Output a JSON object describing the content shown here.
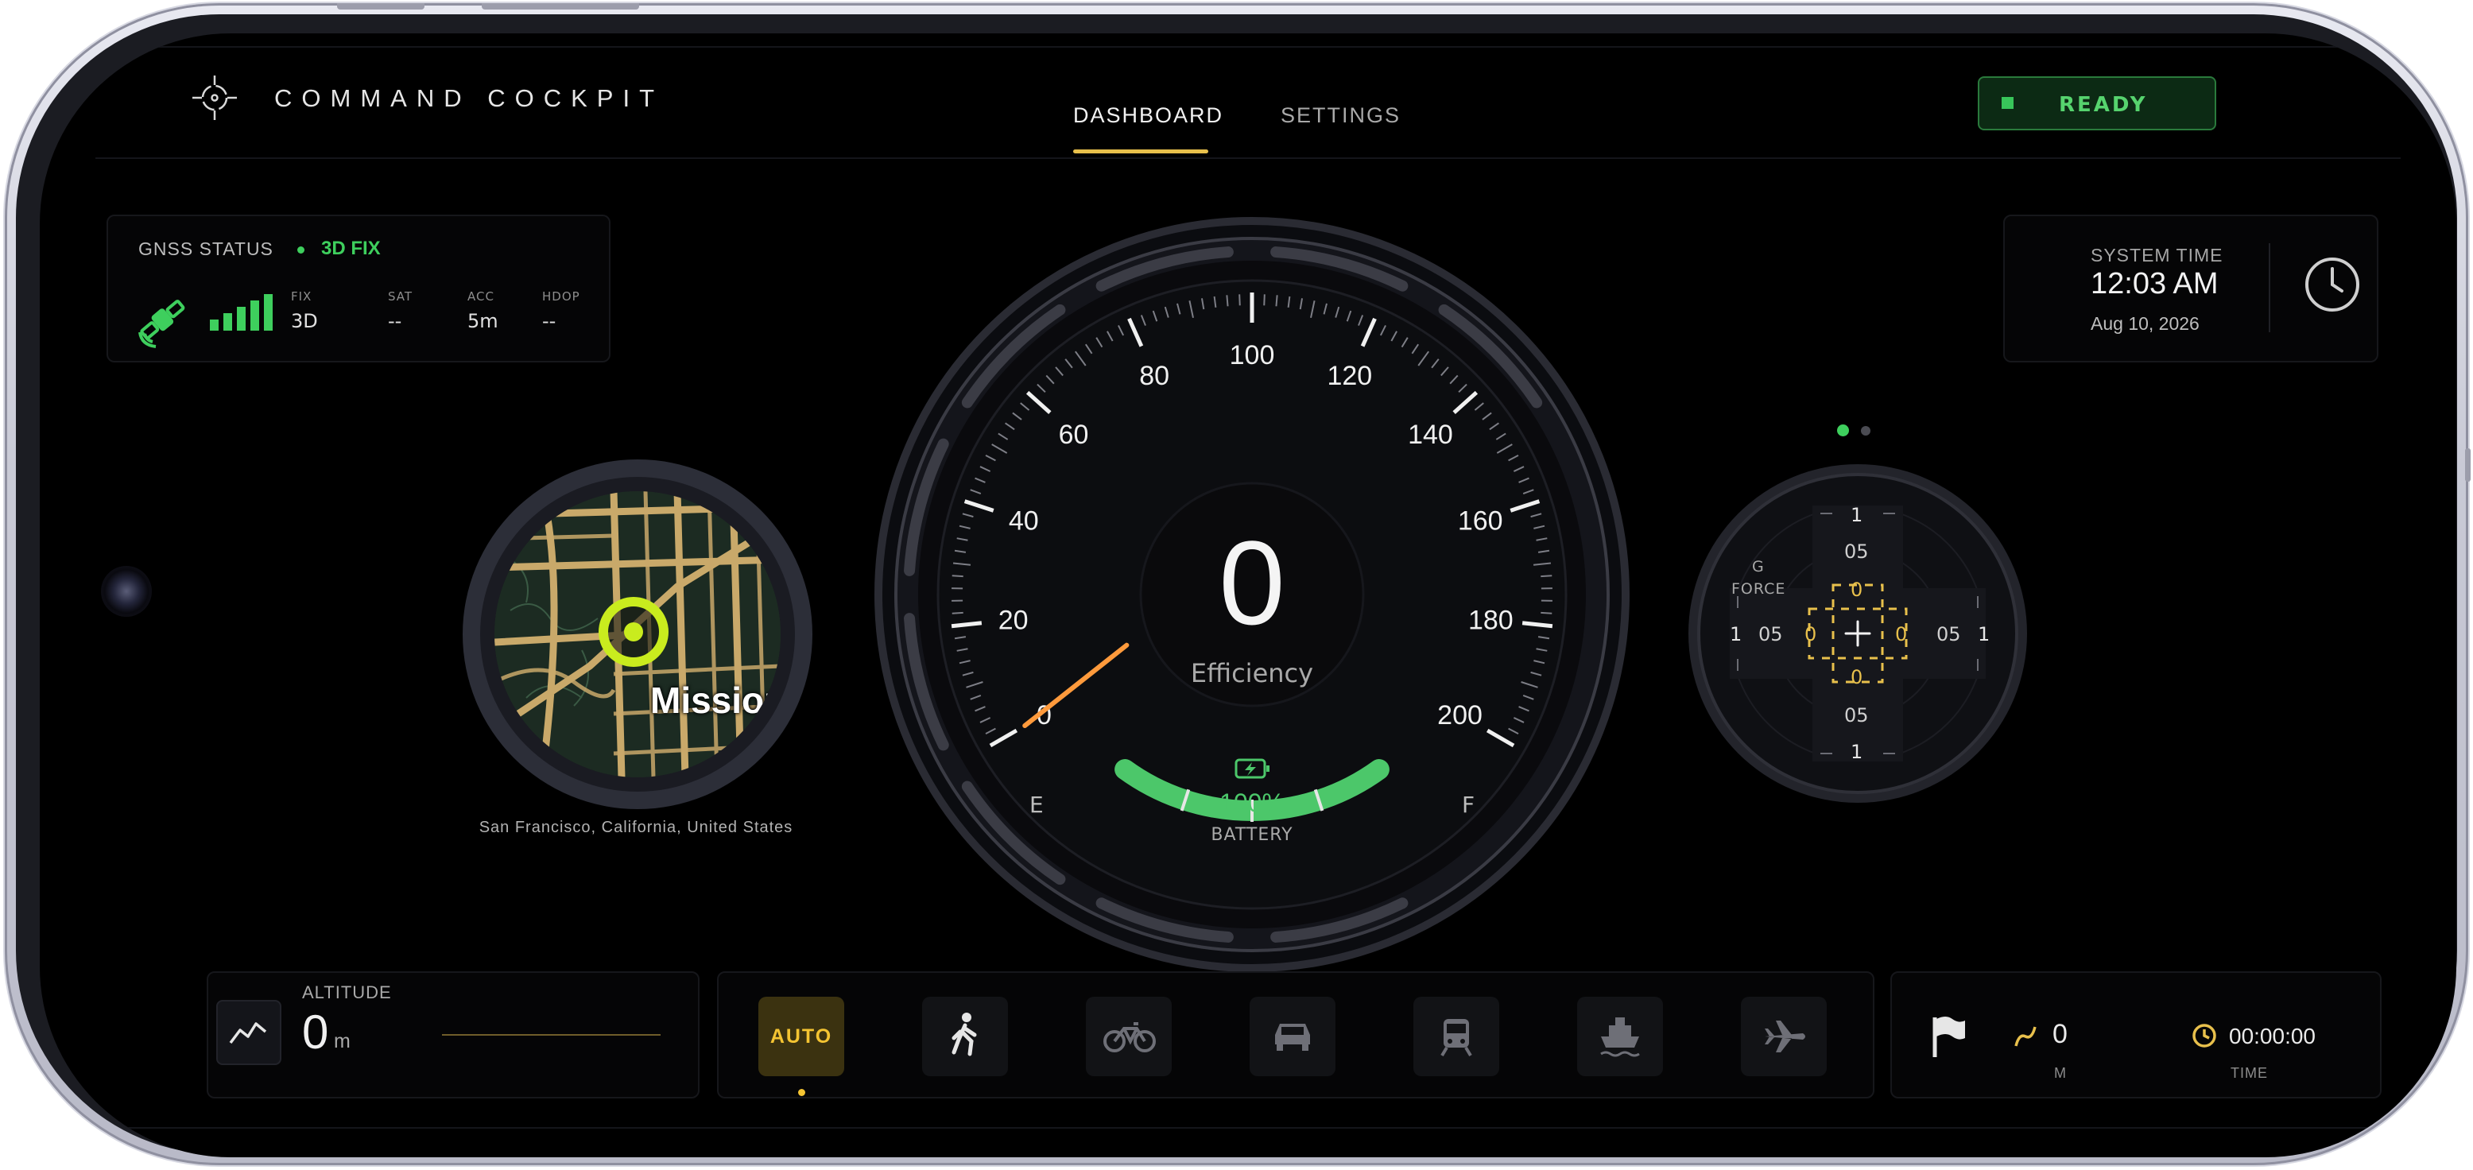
{
  "header": {
    "app_title": "COMMAND COCKPIT",
    "tabs": [
      {
        "label": "DASHBOARD",
        "active": true
      },
      {
        "label": "SETTINGS",
        "active": false
      }
    ],
    "status_label": "READY",
    "logo_icon": "crosshair-icon"
  },
  "gnss": {
    "title": "GNSS STATUS",
    "fix_state": "3D FIX",
    "fields": [
      {
        "label": "FIX",
        "value": "3D"
      },
      {
        "label": "SAT",
        "value": "--"
      },
      {
        "label": "ACC",
        "value": "5m"
      },
      {
        "label": "HDOP",
        "value": "--"
      }
    ],
    "signal_bars": 5,
    "icon": "satellite-icon"
  },
  "system_time": {
    "label": "SYSTEM TIME",
    "time": "12:03 AM",
    "date": "Aug 10, 2026",
    "icon": "clock-icon"
  },
  "map": {
    "place_label": "Mission",
    "caption": "San Francisco, California, United States"
  },
  "speedometer": {
    "value": "0",
    "label": "Efficiency",
    "min": 0,
    "max": 200,
    "ticks": [
      "0",
      "20",
      "40",
      "60",
      "80",
      "100",
      "120",
      "140",
      "160",
      "180",
      "200"
    ],
    "battery_percent_label": "100%",
    "battery_label": "BATTERY",
    "battery_level": 1.0,
    "empty_label": "E",
    "full_label": "F"
  },
  "gforce": {
    "label_line1": "G",
    "label_line2": "FORCE",
    "vertical_scale": [
      "1",
      "05",
      "0",
      "0",
      "05",
      "1"
    ],
    "horizontal_scale": [
      "1",
      "05",
      "0",
      "0",
      "05",
      "1"
    ],
    "pages": 2,
    "active_page": 0
  },
  "altitude": {
    "label": "ALTITUDE",
    "value": "0",
    "unit": "m",
    "icon": "line-chart-icon"
  },
  "modes": {
    "items": [
      {
        "name": "auto",
        "label": "AUTO",
        "selected": true
      },
      {
        "name": "walk",
        "icon": "walking-icon"
      },
      {
        "name": "bike",
        "icon": "bicycle-icon"
      },
      {
        "name": "car",
        "icon": "car-icon"
      },
      {
        "name": "train",
        "icon": "train-icon"
      },
      {
        "name": "boat",
        "icon": "ship-icon"
      },
      {
        "name": "plane",
        "icon": "airplane-icon"
      }
    ]
  },
  "trip": {
    "distance_value": "0",
    "distance_unit": "M",
    "time_value": "00:00:00",
    "time_label": "TIME",
    "flag_icon": "flag-icon"
  },
  "colors": {
    "accent_yellow": "#f4c432",
    "status_green": "#3ecf5d",
    "battery_green": "#4cc76a",
    "needle_orange": "#ff9a3c"
  }
}
